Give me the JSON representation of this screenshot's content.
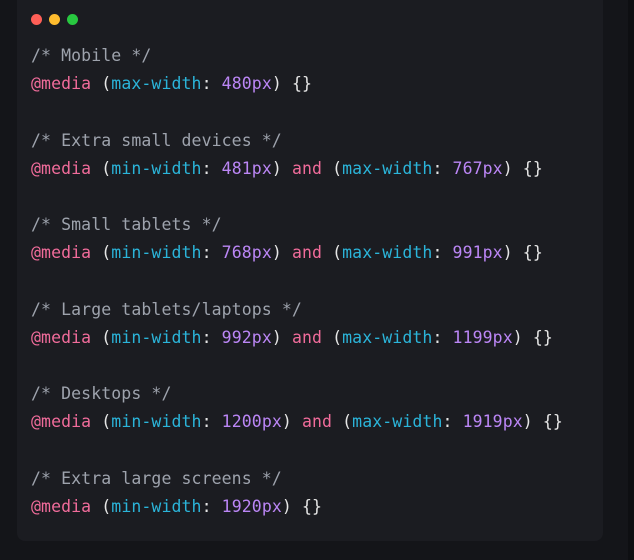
{
  "window": {
    "dots": [
      {
        "name": "close-dot",
        "color": "#ff5f57"
      },
      {
        "name": "minimize-dot",
        "color": "#febc2e"
      },
      {
        "name": "maximize-dot",
        "color": "#28c840"
      }
    ]
  },
  "code": {
    "blocks": [
      {
        "comment": "/* Mobile */",
        "at": "@media",
        "q1_prop": "max-width",
        "q1_num": "480",
        "q1_unit": "px",
        "has_q2": false,
        "tail": " {}"
      },
      {
        "comment": "/* Extra small devices */",
        "at": "@media",
        "q1_prop": "min-width",
        "q1_num": "481",
        "q1_unit": "px",
        "has_q2": true,
        "and": "and",
        "q2_prop": "max-width",
        "q2_num": "767",
        "q2_unit": "px",
        "tail": " {}"
      },
      {
        "comment": "/* Small tablets */",
        "at": "@media",
        "q1_prop": "min-width",
        "q1_num": "768",
        "q1_unit": "px",
        "has_q2": true,
        "and": "and",
        "q2_prop": "max-width",
        "q2_num": "991",
        "q2_unit": "px",
        "tail": " {}"
      },
      {
        "comment": "/* Large tablets/laptops */",
        "at": "@media",
        "q1_prop": "min-width",
        "q1_num": "992",
        "q1_unit": "px",
        "has_q2": true,
        "and": "and",
        "q2_prop": "max-width",
        "q2_num": "1199",
        "q2_unit": "px",
        "tail": " {}"
      },
      {
        "comment": "/* Desktops */",
        "at": "@media",
        "q1_prop": "min-width",
        "q1_num": "1200",
        "q1_unit": "px",
        "has_q2": true,
        "and": "and",
        "q2_prop": "max-width",
        "q2_num": "1919",
        "q2_unit": "px",
        "tail": " {}"
      },
      {
        "comment": "/* Extra large screens */",
        "at": "@media",
        "q1_prop": "min-width",
        "q1_num": "1920",
        "q1_unit": "px",
        "has_q2": false,
        "tail": " {}"
      }
    ]
  },
  "colors": {
    "background": "#141519",
    "panel": "#1b1c21",
    "comment": "#9ea3ad",
    "keyword": "#f16c9b",
    "property": "#2bb4d9",
    "number": "#bb86f5",
    "text": "#e6e6e6"
  }
}
